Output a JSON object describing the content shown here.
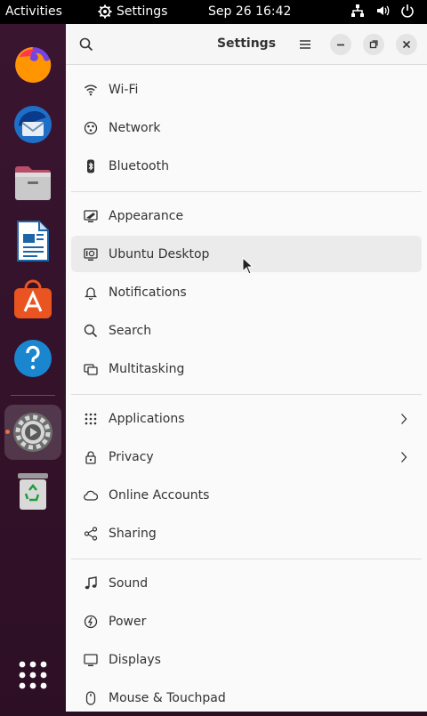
{
  "topbar": {
    "activities": "Activities",
    "app_name": "Settings",
    "clock": "Sep 26  16:42"
  },
  "window": {
    "title": "Settings"
  },
  "groups": [
    [
      {
        "label": "Wi-Fi",
        "icon": "wifi-icon"
      },
      {
        "label": "Network",
        "icon": "network-icon"
      },
      {
        "label": "Bluetooth",
        "icon": "bluetooth-icon"
      }
    ],
    [
      {
        "label": "Appearance",
        "icon": "appearance-icon"
      },
      {
        "label": "Ubuntu Desktop",
        "icon": "ubuntu-desktop-icon"
      },
      {
        "label": "Notifications",
        "icon": "bell-icon"
      },
      {
        "label": "Search",
        "icon": "search-icon"
      },
      {
        "label": "Multitasking",
        "icon": "multitasking-icon"
      }
    ],
    [
      {
        "label": "Applications",
        "icon": "applications-icon"
      },
      {
        "label": "Privacy",
        "icon": "lock-icon"
      },
      {
        "label": "Online Accounts",
        "icon": "cloud-icon"
      },
      {
        "label": "Sharing",
        "icon": "share-icon"
      }
    ],
    [
      {
        "label": "Sound",
        "icon": "music-note-icon"
      },
      {
        "label": "Power",
        "icon": "power-icon"
      },
      {
        "label": "Displays",
        "icon": "display-icon"
      },
      {
        "label": "Mouse & Touchpad",
        "icon": "mouse-icon"
      }
    ]
  ],
  "colors": {
    "accent": "#e95420",
    "dock_bg": "#3a1530",
    "window_bg": "#fafafa"
  }
}
